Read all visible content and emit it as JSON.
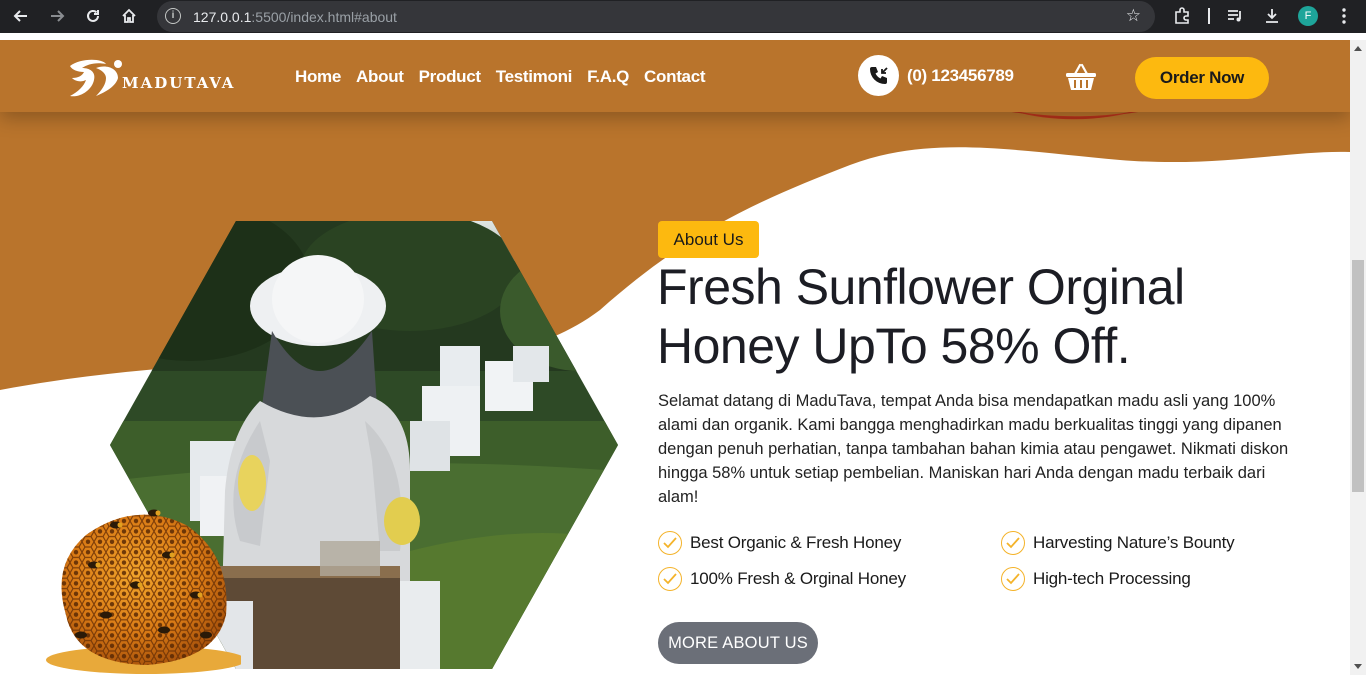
{
  "browser": {
    "url_host": "127.0.0.1",
    "url_rest": ":5500/index.html#about",
    "profile_initial": "F"
  },
  "header": {
    "logo_text": "MADUTAVA",
    "nav": [
      "Home",
      "About",
      "Product",
      "Testimoni",
      "F.A.Q",
      "Contact"
    ],
    "phone": "(0) 123456789",
    "order_button": "Order Now"
  },
  "about": {
    "badge": "About Us",
    "title_line1": "Fresh Sunflower Orginal",
    "title_line2": "Honey UpTo 58% Off.",
    "description": "Selamat datang di MaduTava, tempat Anda bisa mendapatkan madu asli yang 100% alami dan organik. Kami bangga menghadirkan madu berkualitas tinggi yang dipanen dengan penuh perhatian, tanpa tambahan bahan kimia atau pengawet. Nikmati diskon hingga 58% untuk setiap pembelian. Maniskan hari Anda dengan madu terbaik dari alam!",
    "features": [
      "Best Organic & Fresh Honey",
      "Harvesting Nature’s Bounty",
      "100% Fresh & Orginal Honey",
      "High-tech Processing"
    ],
    "more_button": "MORE ABOUT US"
  },
  "colors": {
    "brand_brown": "#b9742c",
    "accent_yellow": "#fdb90f",
    "button_gray": "#6b6f78",
    "check_gold": "#f4b32a"
  }
}
